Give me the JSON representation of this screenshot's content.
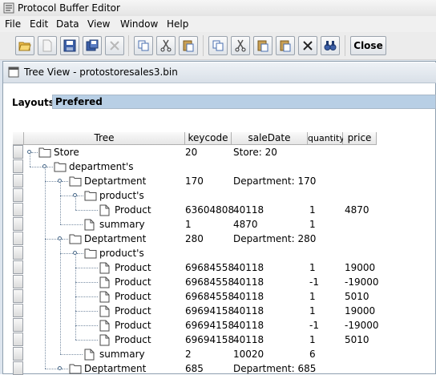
{
  "window": {
    "title": "Protocol Buffer Editor"
  },
  "menu": [
    {
      "label": "File"
    },
    {
      "label": "Edit"
    },
    {
      "label": "Data"
    },
    {
      "label": "View"
    },
    {
      "label": "Window"
    },
    {
      "label": "Help"
    }
  ],
  "toolbar": {
    "buttons": [
      {
        "icon": "open-folder-icon"
      },
      {
        "icon": "new-file-icon"
      },
      {
        "icon": "save-icon"
      },
      {
        "icon": "save-as-icon"
      },
      {
        "icon": "delete-icon"
      },
      {
        "icon": "copy-icon"
      },
      {
        "icon": "cut-icon"
      },
      {
        "icon": "paste-icon"
      },
      {
        "icon": "copy-icon"
      },
      {
        "icon": "cut-icon"
      },
      {
        "icon": "paste-icon"
      },
      {
        "icon": "paste-icon"
      },
      {
        "icon": "delete-icon"
      },
      {
        "icon": "find-icon"
      }
    ],
    "close_label": "Close"
  },
  "frame": {
    "title": "Tree View - protostoresales3.bin"
  },
  "layouts": {
    "label": "Layouts",
    "value": "Prefered"
  },
  "table": {
    "columns": [
      "Tree",
      "keycode",
      "saleDate",
      "quantity",
      "price"
    ],
    "rows": [
      {
        "label": "Store",
        "icon": "folder-icon",
        "cells": [
          "20",
          "Store: 20",
          "",
          ""
        ]
      },
      {
        "label": "department's",
        "icon": "folder-icon",
        "cells": [
          "",
          "",
          "",
          ""
        ]
      },
      {
        "label": "Deptartment",
        "icon": "folder-icon",
        "cells": [
          "170",
          "Department: 170",
          "",
          ""
        ]
      },
      {
        "label": "product's",
        "icon": "folder-icon",
        "cells": [
          "",
          "",
          "",
          ""
        ]
      },
      {
        "label": "Product",
        "icon": "file-icon",
        "cells": [
          "63604808",
          "40118",
          "1",
          "4870"
        ]
      },
      {
        "label": "summary",
        "icon": "file-icon",
        "cells": [
          "1",
          "4870",
          "1",
          ""
        ]
      },
      {
        "label": "Deptartment",
        "icon": "folder-icon",
        "cells": [
          "280",
          "Department: 280",
          "",
          ""
        ]
      },
      {
        "label": "product's",
        "icon": "folder-icon",
        "cells": [
          "",
          "",
          "",
          ""
        ]
      },
      {
        "label": "Product",
        "icon": "file-icon",
        "cells": [
          "69684558",
          "40118",
          "1",
          "19000"
        ]
      },
      {
        "label": "Product",
        "icon": "file-icon",
        "cells": [
          "69684558",
          "40118",
          "-1",
          "-19000"
        ]
      },
      {
        "label": "Product",
        "icon": "file-icon",
        "cells": [
          "69684558",
          "40118",
          "1",
          "5010"
        ]
      },
      {
        "label": "Product",
        "icon": "file-icon",
        "cells": [
          "69694158",
          "40118",
          "1",
          "19000"
        ]
      },
      {
        "label": "Product",
        "icon": "file-icon",
        "cells": [
          "69694158",
          "40118",
          "-1",
          "-19000"
        ]
      },
      {
        "label": "Product",
        "icon": "file-icon",
        "cells": [
          "69694158",
          "40118",
          "1",
          "5010"
        ]
      },
      {
        "label": "summary",
        "icon": "file-icon",
        "cells": [
          "2",
          "10020",
          "6",
          ""
        ]
      },
      {
        "label": "Deptartment",
        "icon": "folder-icon",
        "cells": [
          "685",
          "Department: 685",
          "",
          ""
        ]
      }
    ]
  }
}
